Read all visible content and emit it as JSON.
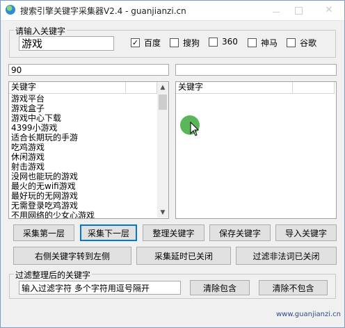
{
  "window": {
    "title": "搜索引擎关键字采集器V2.4 - guanjianzi.cn"
  },
  "keyword_group": {
    "title": "请输入关键字",
    "keyword_value": "游戏",
    "engines": [
      {
        "label": "百度",
        "checked": true
      },
      {
        "label": "搜狗",
        "checked": false
      },
      {
        "label": "360",
        "checked": false
      },
      {
        "label": "神马",
        "checked": false
      },
      {
        "label": "谷歌",
        "checked": false
      }
    ]
  },
  "left_count": "90",
  "right_count": "",
  "left_list": {
    "header": "关键字",
    "rows": [
      "游戏平台",
      "游戏盒子",
      "游戏中心下载",
      "4399小游戏",
      "适合长期玩的手游",
      "吃鸡游戏",
      "休闲游戏",
      "射击游戏",
      "没网也能玩的游戏",
      "最火的无wifi游戏",
      "最好玩的无网游戏",
      "无需登录吃鸡游戏",
      "不用网络的少女心游戏"
    ]
  },
  "right_list": {
    "header": "关键字",
    "rows": []
  },
  "buttons_row1": [
    "采集第一层",
    "采集下一层",
    "整理关键字",
    "保存关键字",
    "导入关键字"
  ],
  "buttons_row2": [
    "右侧关键字转到左侧",
    "采集延时已关闭",
    "过滤非法词已关闭"
  ],
  "filter_group": {
    "title": "过滤整理后的关键字",
    "input_value": "输入过滤字符 多个字符用逗号隔开",
    "clear_include": "清除包含",
    "clear_exclude": "清除不包含"
  },
  "footer_url": "www.guanjianzi.cn",
  "icons": {
    "app": "globe-icon",
    "checkmark": "✓",
    "scroll_up": "▲",
    "scroll_down": "▼"
  },
  "colors": {
    "focus": "#0078d7",
    "cursor_highlight": "#3caa3c"
  }
}
